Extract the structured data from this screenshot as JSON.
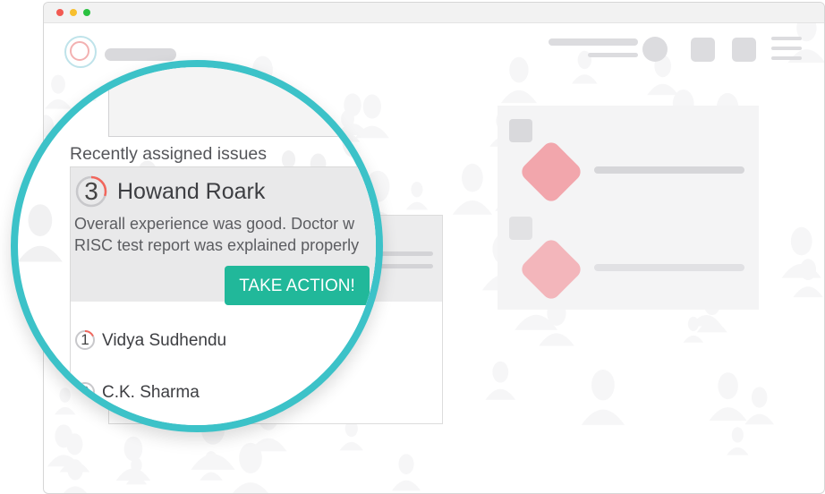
{
  "colors": {
    "accent_ring": "#3cc2c8",
    "action_button": "#21b89a",
    "progress_arc": "#f2665c",
    "diamond": "#f2a6ac"
  },
  "window": {
    "controls": [
      "close",
      "minimize",
      "maximize"
    ]
  },
  "issues_panel": {
    "heading": "Recently assigned issues",
    "featured_issue": {
      "count": "3",
      "name": "Howand Roark",
      "text_line_1": "Overall experience was good. Doctor w",
      "text_line_2": "RISC test report was explained properly",
      "action_label": "TAKE ACTION!"
    },
    "other_issues": [
      {
        "count": "1",
        "name": "Vidya Sudhendu"
      },
      {
        "count": "0",
        "name": "C.K. Sharma"
      }
    ]
  }
}
